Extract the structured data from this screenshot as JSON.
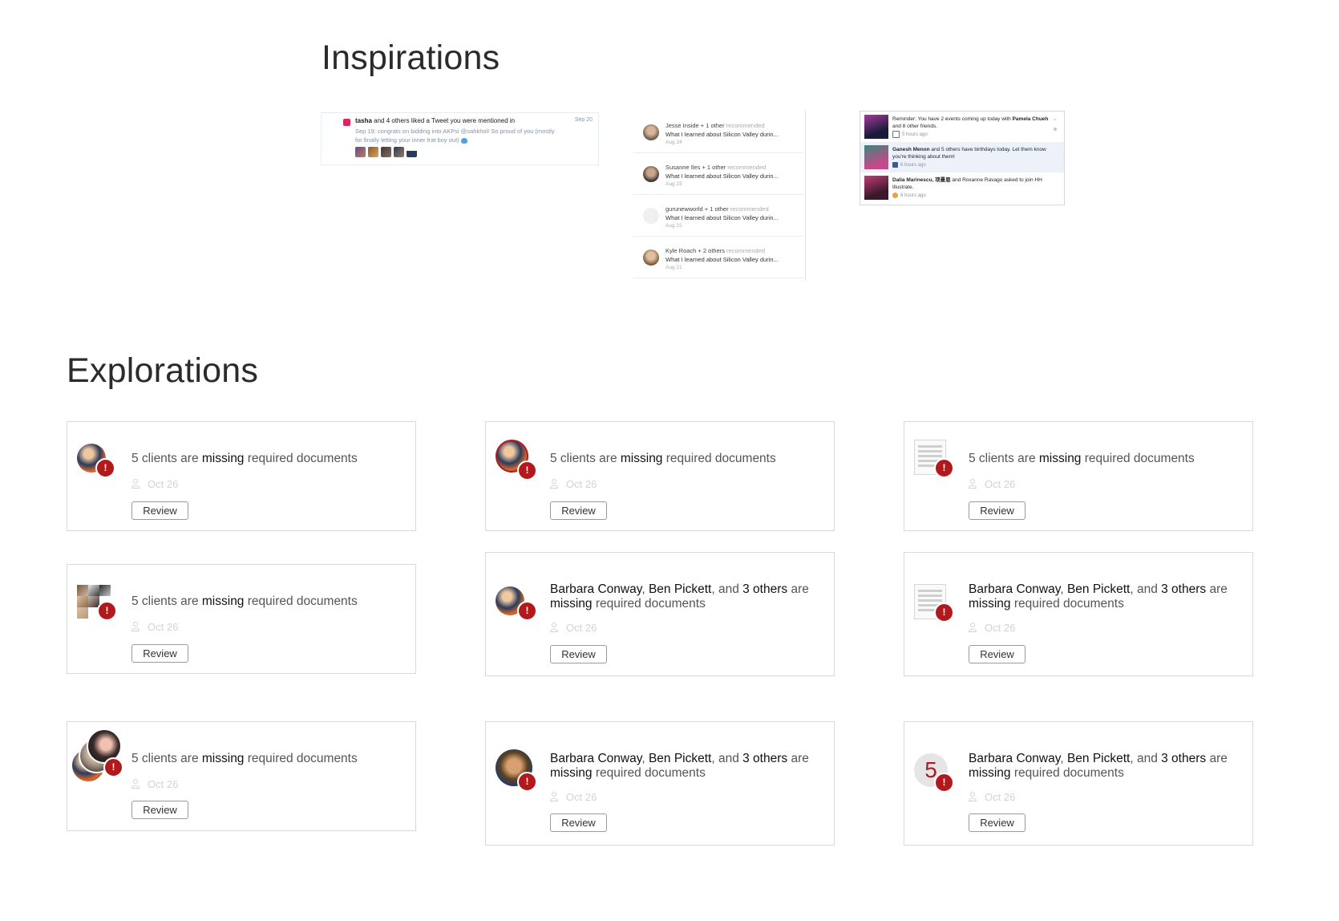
{
  "headings": {
    "inspirations": "Inspirations",
    "explorations": "Explorations"
  },
  "twitter": {
    "user": "tasha",
    "line1_rest": " and 4 others liked a Tweet you were mentioned in",
    "date": "Sep 20",
    "line2": "Sep 19: congrats on bidding into AKPsi @sahkhol! So proud of you (mostly for finally letting your inner frat boy out)"
  },
  "medium": [
    {
      "who": "Jesse Inside + 1 other",
      "action": " recommended",
      "title": "What I learned about Silicon Valley durin...",
      "date": "Aug 24"
    },
    {
      "who": "Susanne Iles + 1 other",
      "action": " recommended",
      "title": "What I learned about Silicon Valley durin...",
      "date": "Aug 23"
    },
    {
      "who": "gurunewworld + 1 other",
      "action": " recommended",
      "title": "What I learned about Silicon Valley durin...",
      "date": "Aug 22"
    },
    {
      "who": "Kyle Roach + 2 others",
      "action": " recommended",
      "title": "What I learned about Silicon Valley durin...",
      "date": "Aug 21"
    }
  ],
  "facebook": [
    {
      "pre": "Reminder: You have 2 events coming up today with ",
      "bold": "Pamela Chueh",
      "post": " and 8 other friends.",
      "time": "5 hours ago"
    },
    {
      "pre": "",
      "bold": "Ganesh Menon",
      "post": " and 5 others have birthdays today. Let them know you're thinking about them!",
      "time": "6 hours ago"
    },
    {
      "pre": "",
      "bold": "Dalia Marinescu, 项曼恩",
      "post": " and Roxanne Ravago asked to join HH Illustrate.",
      "time": "6 hours ago"
    }
  ],
  "cards": {
    "short": {
      "count": "5 clients are ",
      "kw": "missing",
      "rest": " required documents"
    },
    "long": {
      "n1": "Barbara Conway",
      "sep1": ", ",
      "n2": "Ben Pickett",
      "sep2": ", and ",
      "n3": "3 others",
      "are": " are ",
      "kw": "missing",
      "rest": " required documents"
    },
    "date": "Oct 26",
    "button": "Review",
    "badge": "!",
    "number": "5"
  },
  "colors": {
    "badge": "#b2191c",
    "border": "#d9d9d9",
    "heading": "#2b2b2b"
  }
}
